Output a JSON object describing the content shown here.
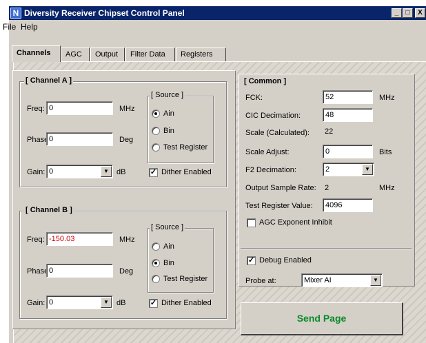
{
  "window": {
    "title": "Diversity Receiver Chipset Control Panel",
    "icon": "app-logo-icon"
  },
  "caption_buttons": {
    "minimize": "_",
    "maximize": "□",
    "close": "X"
  },
  "menu": [
    "File",
    "Help"
  ],
  "tabs": [
    "Channels",
    "AGC",
    "Output",
    "Filter Data",
    "Registers"
  ],
  "active_tab": "Channels",
  "channel_a": {
    "title": "[ Channel A ]",
    "freq_label": "Freq:",
    "freq_value": "0",
    "freq_unit": "MHz",
    "phase_label": "Phase:",
    "phase_value": "0",
    "phase_unit": "Deg",
    "gain_label": "Gain:",
    "gain_value": "0",
    "gain_unit": "dB",
    "source_title": "[ Source ]",
    "sources": [
      "Ain",
      "Bin",
      "Test Register"
    ],
    "selected_source": "Ain",
    "dither_label": "Dither Enabled",
    "dither_checked": true
  },
  "channel_b": {
    "title": "[ Channel B ]",
    "freq_label": "Freq:",
    "freq_value": "-150.03",
    "freq_unit": "MHz",
    "phase_label": "Phase:",
    "phase_value": "0",
    "phase_unit": "Deg",
    "gain_label": "Gain:",
    "gain_value": "0",
    "gain_unit": "dB",
    "source_title": "[ Source ]",
    "sources": [
      "Ain",
      "Bin",
      "Test Register"
    ],
    "selected_source": "Bin",
    "dither_label": "Dither Enabled",
    "dither_checked": true
  },
  "common": {
    "title": "[ Common ]",
    "fck_label": "FCK:",
    "fck_value": "52",
    "fck_unit": "MHz",
    "cic_label": "CIC Decimation:",
    "cic_value": "48",
    "scale_calc_label": "Scale (Calculated):",
    "scale_calc_value": "22",
    "scale_adjust_label": "Scale Adjust:",
    "scale_adjust_value": "0",
    "scale_adjust_unit": "Bits",
    "f2_label": "F2 Decimation:",
    "f2_value": "2",
    "osr_label": "Output Sample Rate:",
    "osr_value": "2",
    "osr_unit": "MHz",
    "test_reg_label": "Test Register Value:",
    "test_reg_value": "4096",
    "agc_inhibit_label": "AGC Exponent Inhibit",
    "agc_inhibit_checked": false
  },
  "debug": {
    "debug_label": "Debug Enabled",
    "debug_checked": true,
    "probe_label": "Probe at:",
    "probe_value": "Mixer AI"
  },
  "send_button": "Send Page",
  "colors": {
    "titlebar": "#0a246a",
    "send_text": "#0a8a2a",
    "error_text": "#d00000",
    "face": "#d4d0c8"
  }
}
